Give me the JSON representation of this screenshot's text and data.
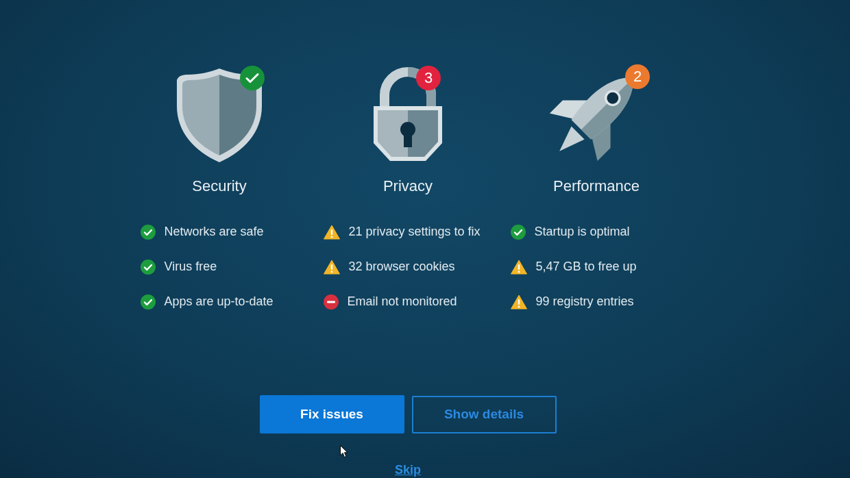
{
  "categories": [
    {
      "kind": "shield",
      "title": "Security",
      "badge": {
        "kind": "check",
        "color": "#17923a"
      },
      "items": [
        {
          "kind": "ok",
          "text": "Networks are safe"
        },
        {
          "kind": "ok",
          "text": "Virus free"
        },
        {
          "kind": "ok",
          "text": "Apps are up-to-date"
        }
      ]
    },
    {
      "kind": "lock",
      "title": "Privacy",
      "badge": {
        "kind": "count",
        "text": "3",
        "color": "#e2233f"
      },
      "items": [
        {
          "kind": "warning",
          "text": "21 privacy settings to fix"
        },
        {
          "kind": "warning",
          "text": "32 browser cookies"
        },
        {
          "kind": "error",
          "text": "Email not monitored"
        }
      ]
    },
    {
      "kind": "rocket",
      "title": "Performance",
      "badge": {
        "kind": "count",
        "text": "2",
        "color": "#ec7a2e"
      },
      "items": [
        {
          "kind": "ok",
          "text": "Startup is optimal"
        },
        {
          "kind": "warning",
          "text": "5,47 GB to free up"
        },
        {
          "kind": "warning",
          "text": "99 registry entries"
        }
      ]
    }
  ],
  "buttons": [
    {
      "kind": "primary",
      "label": "Fix issues"
    },
    {
      "kind": "outline",
      "label": "Show details"
    }
  ],
  "skip_link": {
    "label": "Skip"
  }
}
